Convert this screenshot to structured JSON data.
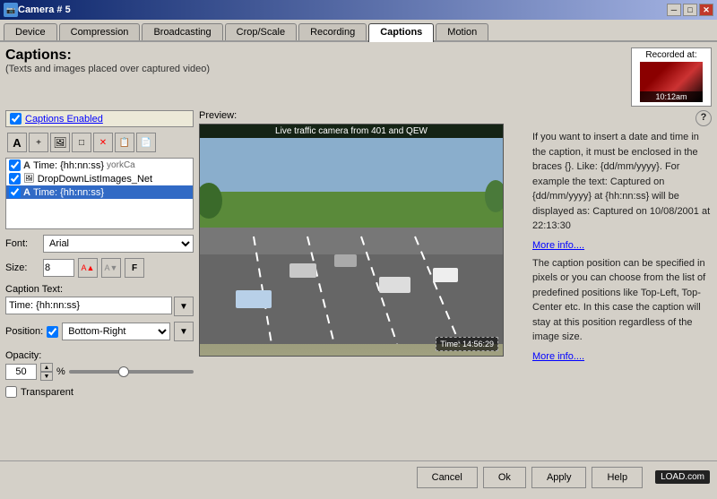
{
  "titleBar": {
    "title": "Camera # 5",
    "minimizeBtn": "─",
    "maximizeBtn": "□",
    "closeBtn": "✕"
  },
  "tabs": [
    {
      "label": "Device",
      "active": false
    },
    {
      "label": "Compression",
      "active": false
    },
    {
      "label": "Broadcasting",
      "active": false
    },
    {
      "label": "Crop/Scale",
      "active": false
    },
    {
      "label": "Recording",
      "active": false
    },
    {
      "label": "Captions",
      "active": true
    },
    {
      "label": "Motion",
      "active": false
    }
  ],
  "pageTitle": "Captions:",
  "pageSubtitle": "(Texts and images placed over captured video)",
  "recordedAt": {
    "label": "Recorded at:",
    "time": "10:12am"
  },
  "captionsEnabled": {
    "checkboxChecked": true,
    "label": "Captions Enabled"
  },
  "toolbarButtons": [
    {
      "name": "text-tool",
      "symbol": "A"
    },
    {
      "name": "add-btn",
      "symbol": "+"
    },
    {
      "name": "image-tool",
      "symbol": "🖼"
    },
    {
      "name": "rect-tool",
      "symbol": "□"
    },
    {
      "name": "delete-btn",
      "symbol": "✕"
    },
    {
      "name": "copy-btn",
      "symbol": "📋"
    },
    {
      "name": "paste-btn",
      "symbol": "📄"
    }
  ],
  "captionItems": [
    {
      "checked": true,
      "type": "A",
      "text": "Time: {hh:nn:ss}",
      "extra": "yorkCa",
      "selected": false
    },
    {
      "checked": true,
      "type": "img",
      "text": "DropDownListImages_Net",
      "extra": "",
      "selected": false
    },
    {
      "checked": true,
      "type": "A",
      "text": "Time: {hh:nn:ss}",
      "extra": "",
      "selected": true
    }
  ],
  "fontRow": {
    "label": "Font:",
    "value": "Arial"
  },
  "sizeRow": {
    "label": "Size:",
    "value": "8",
    "buttons": [
      "A↑",
      "A↓",
      "F"
    ]
  },
  "captionTextRow": {
    "label": "Caption Text:",
    "value": "Time: {hh:nn:ss}"
  },
  "positionRow": {
    "label": "Position:",
    "checkboxChecked": true,
    "value": "Bottom-Right"
  },
  "opacitySection": {
    "label": "Opacity:",
    "value": "50",
    "unit": "%",
    "sliderPos": 40
  },
  "transparentRow": {
    "label": "Transparent"
  },
  "preview": {
    "label": "Preview:",
    "cameraLabel": "Live traffic camera from 401 and QEW",
    "captionOverlay": "Time: 14:56:29"
  },
  "helpText1": "If you want to insert a date and time in the caption, it must be enclosed in the braces {}. Like: {dd/mm/yyyy}. For example the text: Captured on {dd/mm/yyyy} at {hh:nn:ss} will be displayed as: Captured on 10/08/2001 at 22:13:30",
  "moreInfo1": "More info....",
  "helpText2": "The caption position can be specified in pixels or you can choose from the list of predefined positions like Top-Left, Top-Center etc. In this case the caption will stay at this position regardless of the image size.",
  "moreInfo2": "More info....",
  "bottomButtons": [
    {
      "label": "Cancel",
      "name": "cancel-button"
    },
    {
      "label": "Ok",
      "name": "ok-button"
    },
    {
      "label": "Apply",
      "name": "apply-button"
    },
    {
      "label": "Help",
      "name": "help-button"
    }
  ]
}
